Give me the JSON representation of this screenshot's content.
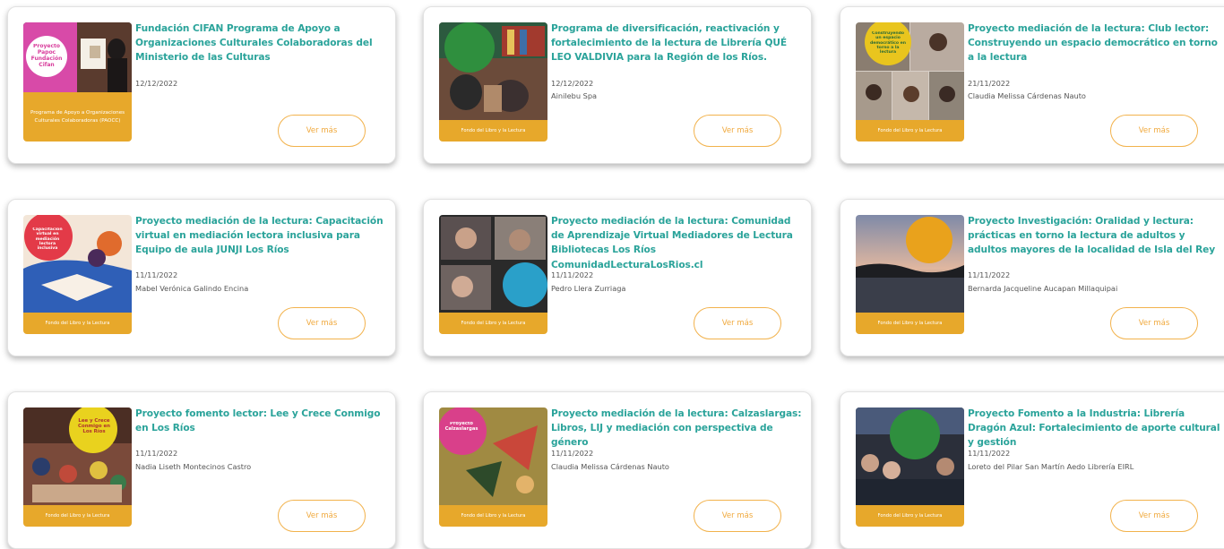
{
  "colors": {
    "title": "#2aa39a",
    "button": "#f0a93d",
    "thumb_bar": "#e7a82b"
  },
  "button_label": "Ver más",
  "cards": [
    {
      "title": "Fundación CIFAN Programa de Apoyo a Organizaciones Culturales Colaboradoras del Ministerio de las Culturas",
      "date": "12/12/2022",
      "author": "",
      "thumb_caption": "Programa de Apoyo a Organizaciones Culturales Colaboradoras (PAOCC)",
      "thumb_bubble": "Proyecto Papoc Fundación Cifan"
    },
    {
      "title": "Programa de diversificación, reactivación y fortalecimiento de la lectura de Librería QUÉ LEO VALDIVIA para la Región de los Ríos.",
      "date": "12/12/2022",
      "author": "Ainilebu Spa",
      "thumb_caption": "Fondo del Libro y la Lectura",
      "thumb_bubble": ""
    },
    {
      "title": "Proyecto mediación de la lectura: Club lector: Construyendo un espacio democrático en torno a la lectura",
      "date": "21/11/2022",
      "author": "Claudia Melissa Cárdenas Nauto",
      "thumb_caption": "Fondo del Libro y la Lectura",
      "thumb_bubble": "Construyendo un espacio democrático en torno a la lectura"
    },
    {
      "title": "Proyecto mediación de la lectura: Capacitación virtual en mediación lectora inclusiva para Equipo de aula JUNJI Los Ríos",
      "date": "11/11/2022",
      "author": "Mabel Verónica Galindo Encina",
      "thumb_caption": "Fondo del Libro y la Lectura",
      "thumb_bubble": "Capacitación virtual en mediación lectora inclusiva"
    },
    {
      "title": "Proyecto mediación de la lectura: Comunidad de Aprendizaje Virtual Mediadores de Lectura Bibliotecas Los Ríos ComunidadLecturaLosRios.cl",
      "date": "11/11/2022",
      "author": "Pedro Llera Zurriaga",
      "thumb_caption": "Fondo del Libro y la Lectura",
      "thumb_bubble": ""
    },
    {
      "title": "Proyecto Investigación: Oralidad y lectura: prácticas en torno la lectura de adultos y adultos mayores de la localidad de Isla del Rey",
      "date": "11/11/2022",
      "author": "Bernarda Jacqueline Aucapan Millaquipai",
      "thumb_caption": "Fondo del Libro y la Lectura",
      "thumb_bubble": ""
    },
    {
      "title": "Proyecto fomento lector: Lee y Crece Conmigo en Los Ríos",
      "date": "11/11/2022",
      "author": "Nadia Liseth Montecinos Castro",
      "thumb_caption": "Fondo del Libro y la Lectura",
      "thumb_bubble": "Lee y Crece Conmigo en Los Ríos"
    },
    {
      "title": "Proyecto mediación de la lectura: Calzaslargas: Libros, LIJ y mediación con perspectiva de género",
      "date": "11/11/2022",
      "author": "Claudia Melissa Cárdenas Nauto",
      "thumb_caption": "Fondo del Libro y la Lectura",
      "thumb_bubble": "Proyecto Calzaslargas"
    },
    {
      "title": "Proyecto Fomento a la Industria: Librería Dragón Azul: Fortalecimiento de aporte cultural y gestión",
      "date": "11/11/2022",
      "author": "Loreto del Pilar San Martín Aedo Librería EIRL",
      "thumb_caption": "Fondo del Libro y la Lectura",
      "thumb_bubble": ""
    }
  ]
}
